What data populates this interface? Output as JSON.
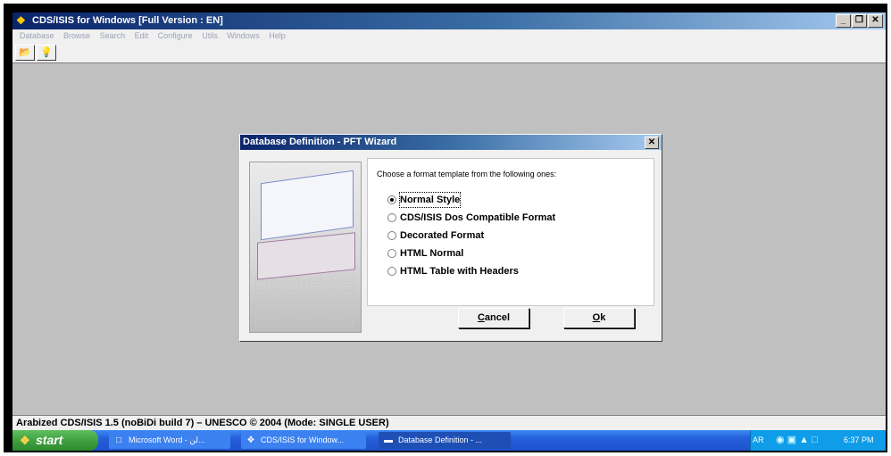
{
  "app": {
    "title": "CDS/ISIS for Windows [Full Version : EN]",
    "icon": "cdsisis-app-icon",
    "menu": [
      "Database",
      "Browse",
      "Search",
      "Edit",
      "Configure",
      "Utils",
      "Windows",
      "Help"
    ],
    "window_buttons": {
      "minimize": "_",
      "restore": "❐",
      "close": "✕"
    }
  },
  "toolbar": {
    "buttons": [
      {
        "name": "open-folder-icon",
        "glyph": "📂"
      },
      {
        "name": "lightbulb-icon",
        "glyph": "💡"
      }
    ]
  },
  "dialog": {
    "title": "Database Definition - PFT Wizard",
    "close_glyph": "✕",
    "prompt": "Choose a format template from the following ones:",
    "options": [
      {
        "label": "Normal Style",
        "checked": true
      },
      {
        "label": "CDS/ISIS Dos Compatible Format",
        "checked": false
      },
      {
        "label": "Decorated Format",
        "checked": false
      },
      {
        "label": "HTML Normal",
        "checked": false
      },
      {
        "label": "HTML Table with Headers",
        "checked": false
      }
    ],
    "cancel_label": {
      "first": "C",
      "rest": "ancel"
    },
    "ok_label": {
      "first": "O",
      "rest": "k"
    }
  },
  "statusbar": {
    "text": "Arabized CDS/ISIS 1.5 (noBiDi build 7) – UNESCO © 2004 (Mode: SINGLE USER)"
  },
  "taskbar": {
    "start_label": "start",
    "tasks": [
      {
        "label": "Microsoft Word - لن...",
        "icon": "word-icon",
        "active": false
      },
      {
        "label": "CDS/ISIS for Window...",
        "icon": "cdsisis-icon",
        "active": false
      },
      {
        "label": "Database Definition - ...",
        "icon": "window-icon",
        "active": true
      }
    ],
    "language": "AR",
    "time": "6:37 PM"
  },
  "colors": {
    "title_active": "#0a246a",
    "desktop": "#c0c0c0",
    "taskbar": "#245edb",
    "start": "#3c9c3c"
  }
}
